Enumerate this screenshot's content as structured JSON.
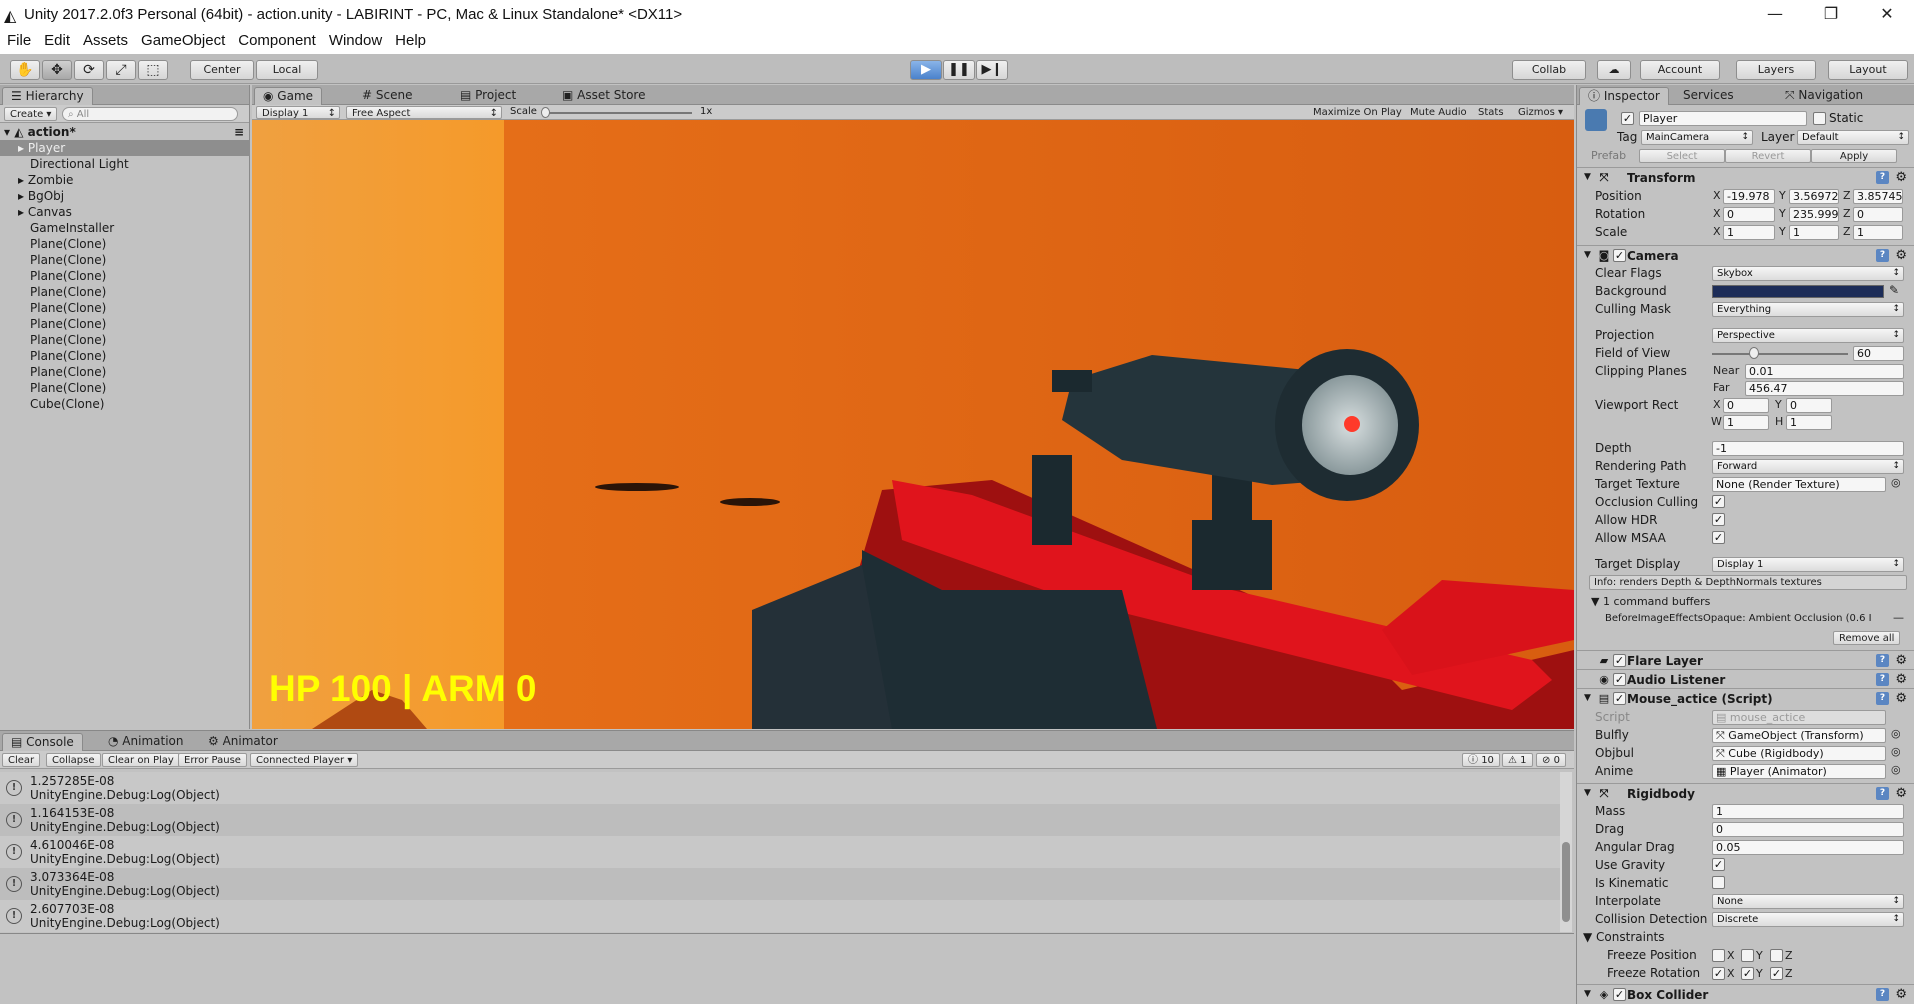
{
  "window": {
    "title": "Unity 2017.2.0f3 Personal (64bit) - action.unity - LABIRINT - PC, Mac & Linux Standalone* <DX11>",
    "minimize": "—",
    "maximize": "❐",
    "close": "✕"
  },
  "menu": [
    "File",
    "Edit",
    "Assets",
    "GameObject",
    "Component",
    "Window",
    "Help"
  ],
  "toolbar": {
    "tools": [
      "✋",
      "✥",
      "⟳",
      "⤢",
      "⬚"
    ],
    "pivot": "Center",
    "space": "Local",
    "play": "▶",
    "pause": "❚❚",
    "step": "▶❙",
    "collab": "Collab",
    "cloud": "☁",
    "account": "Account",
    "layers": "Layers",
    "layout": "Layout"
  },
  "hierarchy": {
    "tab": "Hierarchy",
    "create": "Create",
    "search_placeholder": "All",
    "scene": "action*",
    "items": [
      "Player",
      "Directional Light",
      "Zombie",
      "BgObj",
      "Canvas",
      "GameInstaller",
      "Plane(Clone)",
      "Plane(Clone)",
      "Plane(Clone)",
      "Plane(Clone)",
      "Plane(Clone)",
      "Plane(Clone)",
      "Plane(Clone)",
      "Plane(Clone)",
      "Plane(Clone)",
      "Plane(Clone)",
      "Cube(Clone)"
    ]
  },
  "game": {
    "tabs": [
      "Game",
      "Scene",
      "Project",
      "Asset Store"
    ],
    "display": "Display 1",
    "aspect": "Free Aspect",
    "scale_label": "Scale",
    "scale_value": "1x",
    "scale_fraction": 0.0,
    "buttons": [
      "Maximize On Play",
      "Mute Audio",
      "Stats",
      "Gizmos"
    ],
    "hud": "HP 100 | ARM 0",
    "hud_color": "#ffff00",
    "bg_color": "#e0721c"
  },
  "console": {
    "tabs": [
      "Console",
      "Animation",
      "Animator"
    ],
    "buttons": [
      "Clear",
      "Collapse",
      "Clear on Play",
      "Error Pause",
      "Connected Player"
    ],
    "counts": {
      "logs": "10",
      "warnings": "1",
      "errors": "0"
    },
    "entries": [
      {
        "value": "1.257285E-08",
        "source": "UnityEngine.Debug:Log(Object)"
      },
      {
        "value": "1.164153E-08",
        "source": "UnityEngine.Debug:Log(Object)"
      },
      {
        "value": "4.610046E-08",
        "source": "UnityEngine.Debug:Log(Object)"
      },
      {
        "value": "3.073364E-08",
        "source": "UnityEngine.Debug:Log(Object)"
      },
      {
        "value": "2.607703E-08",
        "source": "UnityEngine.Debug:Log(Object)"
      }
    ]
  },
  "inspector": {
    "tabs": [
      "Inspector",
      "Services",
      "Navigation"
    ],
    "object_name": "Player",
    "static_label": "Static",
    "tag_label": "Tag",
    "tag": "MainCamera",
    "layer_label": "Layer",
    "layer": "Default",
    "prefab": {
      "label": "Prefab",
      "select": "Select",
      "revert": "Revert",
      "apply": "Apply"
    },
    "transform": {
      "title": "Transform",
      "position_label": "Position",
      "position": [
        "-19.978",
        "3.56972",
        "3.85745"
      ],
      "rotation_label": "Rotation",
      "rotation": [
        "0",
        "235.999",
        "0"
      ],
      "scale_label": "Scale",
      "scale": [
        "1",
        "1",
        "1"
      ]
    },
    "camera": {
      "title": "Camera",
      "clear_flags_label": "Clear Flags",
      "clear_flags": "Skybox",
      "background_label": "Background",
      "background_color": "#1c2c58",
      "culling_mask_label": "Culling Mask",
      "culling_mask": "Everything",
      "projection_label": "Projection",
      "projection": "Perspective",
      "fov_label": "Field of View",
      "fov": "60",
      "clipping_label": "Clipping Planes",
      "near_label": "Near",
      "near": "0.01",
      "far_label": "Far",
      "far": "456.47",
      "viewport_label": "Viewport Rect",
      "vx": "0",
      "vy": "0",
      "vw": "1",
      "vh": "1",
      "depth_label": "Depth",
      "depth": "-1",
      "rendering_path_label": "Rendering Path",
      "rendering_path": "Forward",
      "target_texture_label": "Target Texture",
      "target_texture": "None (Render Texture)",
      "occlusion_label": "Occlusion Culling",
      "hdr_label": "Allow HDR",
      "msaa_label": "Allow MSAA",
      "target_display_label": "Target Display",
      "target_display": "Display 1",
      "info": "Info: renders Depth & DepthNormals textures",
      "cmd_buffers": "1 command buffers",
      "cmd_entry": "BeforeImageEffectsOpaque: Ambient Occlusion (0.6 I",
      "remove_all": "Remove all"
    },
    "flare_layer": "Flare Layer",
    "audio_listener": "Audio Listener",
    "script_comp": {
      "title": "Mouse_actice (Script)",
      "script_label": "Script",
      "script": "mouse_actice",
      "bulfly_label": "Bulfly",
      "bulfly": "GameObject (Transform)",
      "objbul_label": "Objbul",
      "objbul": "Cube (Rigidbody)",
      "anime_label": "Anime",
      "anime": "Player (Animator)"
    },
    "rigidbody": {
      "title": "Rigidbody",
      "mass_label": "Mass",
      "mass": "1",
      "drag_label": "Drag",
      "drag": "0",
      "angular_label": "Angular Drag",
      "angular": "0.05",
      "gravity_label": "Use Gravity",
      "kinematic_label": "Is Kinematic",
      "interpolate_label": "Interpolate",
      "interpolate": "None",
      "collision_label": "Collision Detection",
      "collision": "Discrete",
      "constraints_label": "Constraints",
      "freeze_pos_label": "Freeze Position",
      "freeze_rot_label": "Freeze Rotation"
    },
    "box_collider": "Box Collider",
    "axes": [
      "X",
      "Y",
      "Z"
    ],
    "wh": [
      "W",
      "H"
    ]
  }
}
